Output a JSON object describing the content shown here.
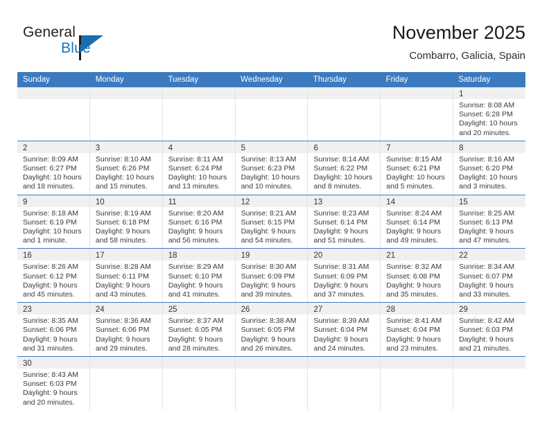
{
  "brand": {
    "name_top": "General",
    "name_bottom": "Blue",
    "accent_color": "#1b75bb",
    "triangle_color": "#1b6cb0"
  },
  "header": {
    "title": "November 2025",
    "subtitle": "Combarro, Galicia, Spain"
  },
  "theme": {
    "header_blue": "#3c7ac0",
    "day_band_gray": "#f0f0f0",
    "cell_divider": "#e3e3e3",
    "text": "#333333"
  },
  "weekdays": [
    "Sunday",
    "Monday",
    "Tuesday",
    "Wednesday",
    "Thursday",
    "Friday",
    "Saturday"
  ],
  "weeks": [
    [
      {
        "day": "",
        "sunrise": "",
        "sunset": "",
        "daylight": "",
        "empty": true
      },
      {
        "day": "",
        "sunrise": "",
        "sunset": "",
        "daylight": "",
        "empty": true
      },
      {
        "day": "",
        "sunrise": "",
        "sunset": "",
        "daylight": "",
        "empty": true
      },
      {
        "day": "",
        "sunrise": "",
        "sunset": "",
        "daylight": "",
        "empty": true
      },
      {
        "day": "",
        "sunrise": "",
        "sunset": "",
        "daylight": "",
        "empty": true
      },
      {
        "day": "",
        "sunrise": "",
        "sunset": "",
        "daylight": "",
        "empty": true
      },
      {
        "day": "1",
        "sunrise": "Sunrise: 8:08 AM",
        "sunset": "Sunset: 6:28 PM",
        "daylight": "Daylight: 10 hours and 20 minutes.",
        "empty": false
      }
    ],
    [
      {
        "day": "2",
        "sunrise": "Sunrise: 8:09 AM",
        "sunset": "Sunset: 6:27 PM",
        "daylight": "Daylight: 10 hours and 18 minutes.",
        "empty": false
      },
      {
        "day": "3",
        "sunrise": "Sunrise: 8:10 AM",
        "sunset": "Sunset: 6:26 PM",
        "daylight": "Daylight: 10 hours and 15 minutes.",
        "empty": false
      },
      {
        "day": "4",
        "sunrise": "Sunrise: 8:11 AM",
        "sunset": "Sunset: 6:24 PM",
        "daylight": "Daylight: 10 hours and 13 minutes.",
        "empty": false
      },
      {
        "day": "5",
        "sunrise": "Sunrise: 8:13 AM",
        "sunset": "Sunset: 6:23 PM",
        "daylight": "Daylight: 10 hours and 10 minutes.",
        "empty": false
      },
      {
        "day": "6",
        "sunrise": "Sunrise: 8:14 AM",
        "sunset": "Sunset: 6:22 PM",
        "daylight": "Daylight: 10 hours and 8 minutes.",
        "empty": false
      },
      {
        "day": "7",
        "sunrise": "Sunrise: 8:15 AM",
        "sunset": "Sunset: 6:21 PM",
        "daylight": "Daylight: 10 hours and 5 minutes.",
        "empty": false
      },
      {
        "day": "8",
        "sunrise": "Sunrise: 8:16 AM",
        "sunset": "Sunset: 6:20 PM",
        "daylight": "Daylight: 10 hours and 3 minutes.",
        "empty": false
      }
    ],
    [
      {
        "day": "9",
        "sunrise": "Sunrise: 8:18 AM",
        "sunset": "Sunset: 6:19 PM",
        "daylight": "Daylight: 10 hours and 1 minute.",
        "empty": false
      },
      {
        "day": "10",
        "sunrise": "Sunrise: 8:19 AM",
        "sunset": "Sunset: 6:18 PM",
        "daylight": "Daylight: 9 hours and 58 minutes.",
        "empty": false
      },
      {
        "day": "11",
        "sunrise": "Sunrise: 8:20 AM",
        "sunset": "Sunset: 6:16 PM",
        "daylight": "Daylight: 9 hours and 56 minutes.",
        "empty": false
      },
      {
        "day": "12",
        "sunrise": "Sunrise: 8:21 AM",
        "sunset": "Sunset: 6:15 PM",
        "daylight": "Daylight: 9 hours and 54 minutes.",
        "empty": false
      },
      {
        "day": "13",
        "sunrise": "Sunrise: 8:23 AM",
        "sunset": "Sunset: 6:14 PM",
        "daylight": "Daylight: 9 hours and 51 minutes.",
        "empty": false
      },
      {
        "day": "14",
        "sunrise": "Sunrise: 8:24 AM",
        "sunset": "Sunset: 6:14 PM",
        "daylight": "Daylight: 9 hours and 49 minutes.",
        "empty": false
      },
      {
        "day": "15",
        "sunrise": "Sunrise: 8:25 AM",
        "sunset": "Sunset: 6:13 PM",
        "daylight": "Daylight: 9 hours and 47 minutes.",
        "empty": false
      }
    ],
    [
      {
        "day": "16",
        "sunrise": "Sunrise: 8:26 AM",
        "sunset": "Sunset: 6:12 PM",
        "daylight": "Daylight: 9 hours and 45 minutes.",
        "empty": false
      },
      {
        "day": "17",
        "sunrise": "Sunrise: 8:28 AM",
        "sunset": "Sunset: 6:11 PM",
        "daylight": "Daylight: 9 hours and 43 minutes.",
        "empty": false
      },
      {
        "day": "18",
        "sunrise": "Sunrise: 8:29 AM",
        "sunset": "Sunset: 6:10 PM",
        "daylight": "Daylight: 9 hours and 41 minutes.",
        "empty": false
      },
      {
        "day": "19",
        "sunrise": "Sunrise: 8:30 AM",
        "sunset": "Sunset: 6:09 PM",
        "daylight": "Daylight: 9 hours and 39 minutes.",
        "empty": false
      },
      {
        "day": "20",
        "sunrise": "Sunrise: 8:31 AM",
        "sunset": "Sunset: 6:09 PM",
        "daylight": "Daylight: 9 hours and 37 minutes.",
        "empty": false
      },
      {
        "day": "21",
        "sunrise": "Sunrise: 8:32 AM",
        "sunset": "Sunset: 6:08 PM",
        "daylight": "Daylight: 9 hours and 35 minutes.",
        "empty": false
      },
      {
        "day": "22",
        "sunrise": "Sunrise: 8:34 AM",
        "sunset": "Sunset: 6:07 PM",
        "daylight": "Daylight: 9 hours and 33 minutes.",
        "empty": false
      }
    ],
    [
      {
        "day": "23",
        "sunrise": "Sunrise: 8:35 AM",
        "sunset": "Sunset: 6:06 PM",
        "daylight": "Daylight: 9 hours and 31 minutes.",
        "empty": false
      },
      {
        "day": "24",
        "sunrise": "Sunrise: 8:36 AM",
        "sunset": "Sunset: 6:06 PM",
        "daylight": "Daylight: 9 hours and 29 minutes.",
        "empty": false
      },
      {
        "day": "25",
        "sunrise": "Sunrise: 8:37 AM",
        "sunset": "Sunset: 6:05 PM",
        "daylight": "Daylight: 9 hours and 28 minutes.",
        "empty": false
      },
      {
        "day": "26",
        "sunrise": "Sunrise: 8:38 AM",
        "sunset": "Sunset: 6:05 PM",
        "daylight": "Daylight: 9 hours and 26 minutes.",
        "empty": false
      },
      {
        "day": "27",
        "sunrise": "Sunrise: 8:39 AM",
        "sunset": "Sunset: 6:04 PM",
        "daylight": "Daylight: 9 hours and 24 minutes.",
        "empty": false
      },
      {
        "day": "28",
        "sunrise": "Sunrise: 8:41 AM",
        "sunset": "Sunset: 6:04 PM",
        "daylight": "Daylight: 9 hours and 23 minutes.",
        "empty": false
      },
      {
        "day": "29",
        "sunrise": "Sunrise: 8:42 AM",
        "sunset": "Sunset: 6:03 PM",
        "daylight": "Daylight: 9 hours and 21 minutes.",
        "empty": false
      }
    ],
    [
      {
        "day": "30",
        "sunrise": "Sunrise: 8:43 AM",
        "sunset": "Sunset: 6:03 PM",
        "daylight": "Daylight: 9 hours and 20 minutes.",
        "empty": false
      },
      {
        "day": "",
        "sunrise": "",
        "sunset": "",
        "daylight": "",
        "empty": true
      },
      {
        "day": "",
        "sunrise": "",
        "sunset": "",
        "daylight": "",
        "empty": true
      },
      {
        "day": "",
        "sunrise": "",
        "sunset": "",
        "daylight": "",
        "empty": true
      },
      {
        "day": "",
        "sunrise": "",
        "sunset": "",
        "daylight": "",
        "empty": true
      },
      {
        "day": "",
        "sunrise": "",
        "sunset": "",
        "daylight": "",
        "empty": true
      },
      {
        "day": "",
        "sunrise": "",
        "sunset": "",
        "daylight": "",
        "empty": true
      }
    ]
  ]
}
